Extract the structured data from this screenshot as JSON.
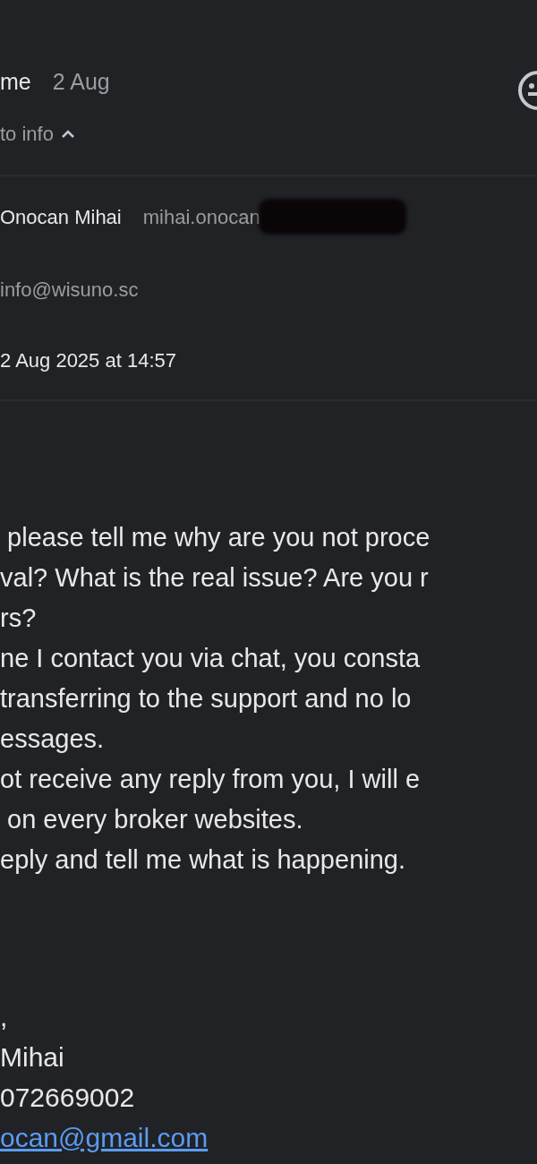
{
  "header": {
    "sender": "me",
    "date": "2 Aug",
    "recipients": "to info",
    "details_expanded": true
  },
  "details": {
    "from_name": "Onocan Mihai",
    "from_email": "mihai.onocan",
    "from_email_redacted": true,
    "to": "info@wisuno.sc",
    "sent": "2 Aug 2025 at 14:57"
  },
  "body_lines": [
    " please tell me why are you not proce",
    "val? What is the real issue? Are you r",
    "rs?",
    "ne I contact you via chat, you consta",
    "transferring to the support and no lo",
    "essages.",
    "ot receive any reply from you, I will e",
    " on every broker websites.",
    "eply and tell me what is happening."
  ],
  "signature": [
    {
      "kind": "text",
      "text": ","
    },
    {
      "kind": "text",
      "text": "Mihai"
    },
    {
      "kind": "text",
      "text": "072669002"
    },
    {
      "kind": "link",
      "text": "ocan@gmail.com"
    }
  ]
}
